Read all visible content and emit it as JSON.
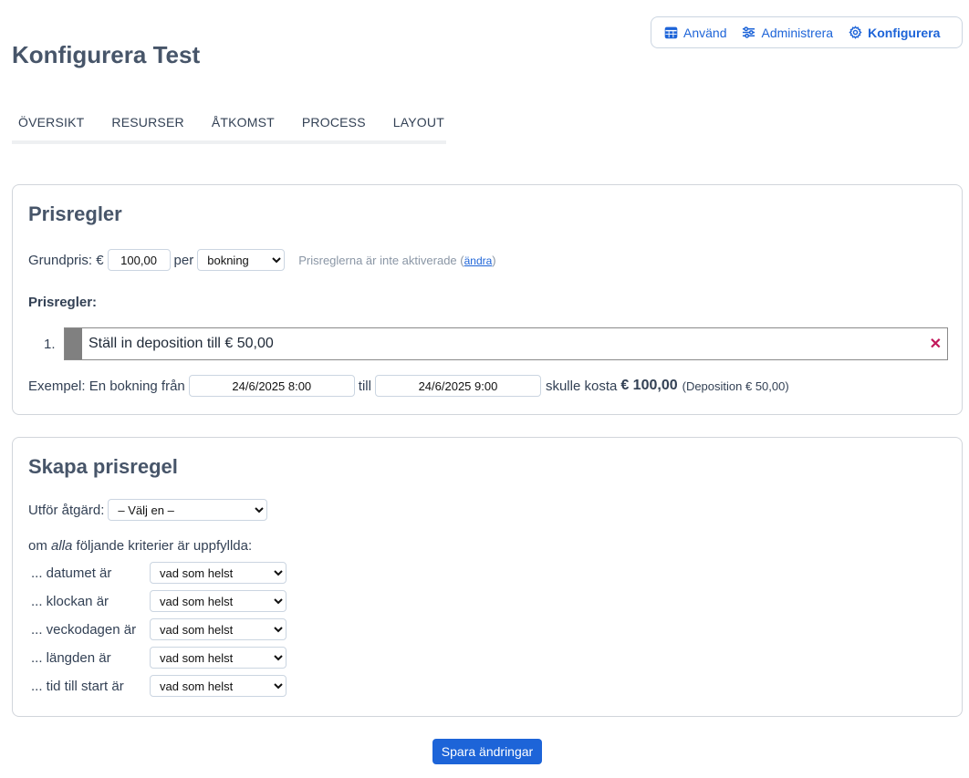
{
  "topnav": {
    "items": [
      {
        "label": "Använd",
        "icon": "calendar-icon"
      },
      {
        "label": "Administrera",
        "icon": "sliders-icon"
      },
      {
        "label": "Konfigurera",
        "icon": "gear-icon"
      }
    ]
  },
  "page": {
    "title": "Konfigurera Test"
  },
  "tabs": [
    "ÖVERSIKT",
    "RESURSER",
    "ÅTKOMST",
    "PROCESS",
    "LAYOUT"
  ],
  "pricing": {
    "heading": "Prisregler",
    "base_price_label": "Grundpris: €",
    "base_price_value": "100,00",
    "per_label": "per",
    "per_unit": "bokning",
    "status_text": "Prisreglerna är inte aktiverade (",
    "status_link": "ändra",
    "status_close": ")",
    "rules_label": "Prisregler:",
    "rules": [
      {
        "number": "1.",
        "text": "Ställ in deposition till € 50,00",
        "remove": "✕"
      }
    ],
    "example": {
      "prefix": "Exempel: En bokning från",
      "from": "24/6/2025 8:00",
      "to_label": "till",
      "to": "24/6/2025 9:00",
      "cost_label": "skulle kosta",
      "cost": "€ 100,00",
      "deposit": "(Deposition € 50,00)"
    }
  },
  "create": {
    "heading": "Skapa prisregel",
    "action_label": "Utför åtgärd:",
    "action_value": "– Välj en –",
    "criteria_prefix": "om",
    "criteria_emph": "alla",
    "criteria_suffix": "följande kriterier är uppfyllda:",
    "criteria": [
      {
        "label": "... datumet är",
        "value": "vad som helst"
      },
      {
        "label": "... klockan är",
        "value": "vad som helst"
      },
      {
        "label": "... veckodagen är",
        "value": "vad som helst"
      },
      {
        "label": "... längden är",
        "value": "vad som helst"
      },
      {
        "label": "... tid till start är",
        "value": "vad som helst"
      }
    ]
  },
  "save_button": "Spara ändringar",
  "colors": {
    "accent": "#1d64d8",
    "remove": "#c2185b"
  }
}
